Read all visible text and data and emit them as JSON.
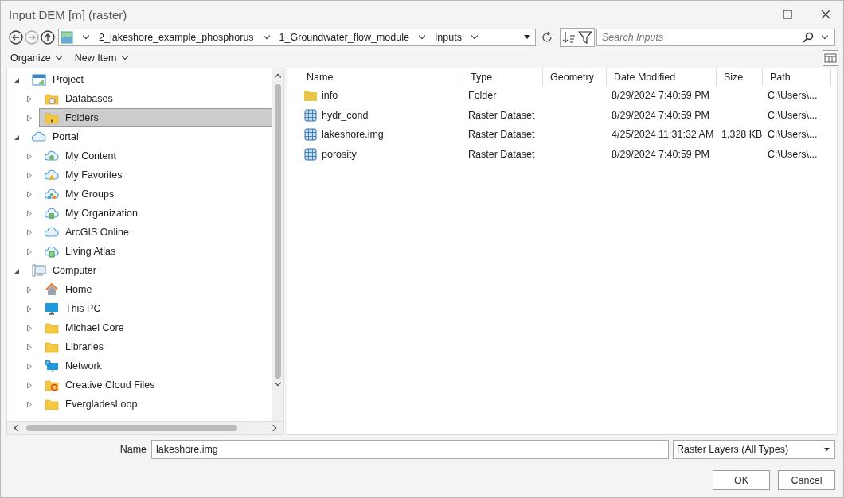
{
  "window": {
    "title": "Input DEM [m] (raster)"
  },
  "breadcrumb": [
    "2_lakeshore_example_phosphorus",
    "1_Groundwater_flow_module",
    "Inputs"
  ],
  "search": {
    "placeholder": "Search Inputs"
  },
  "toolbar": [
    "Organize",
    "New Item"
  ],
  "tree": [
    {
      "label": "Project",
      "kind": "project",
      "expanded": true,
      "selected": false,
      "children": [
        {
          "label": "Databases",
          "kind": "database",
          "expanded": false,
          "selected": false
        },
        {
          "label": "Folders",
          "kind": "homefolder",
          "expanded": false,
          "selected": true
        }
      ]
    },
    {
      "label": "Portal",
      "kind": "cloud",
      "expanded": true,
      "selected": false,
      "children": [
        {
          "label": "My Content",
          "kind": "content",
          "expanded": false,
          "selected": false
        },
        {
          "label": "My Favorites",
          "kind": "favorites",
          "expanded": false,
          "selected": false
        },
        {
          "label": "My Groups",
          "kind": "groups",
          "expanded": false,
          "selected": false
        },
        {
          "label": "My Organization",
          "kind": "organization",
          "expanded": false,
          "selected": false
        },
        {
          "label": "ArcGIS Online",
          "kind": "cloud",
          "expanded": false,
          "selected": false
        },
        {
          "label": "Living Atlas",
          "kind": "atlas",
          "expanded": false,
          "selected": false
        }
      ]
    },
    {
      "label": "Computer",
      "kind": "computer",
      "expanded": true,
      "selected": false,
      "children": [
        {
          "label": "Home",
          "kind": "home",
          "expanded": false,
          "selected": false
        },
        {
          "label": "This PC",
          "kind": "pc",
          "expanded": false,
          "selected": false
        },
        {
          "label": "Michael Core",
          "kind": "folder",
          "expanded": false,
          "selected": false
        },
        {
          "label": "Libraries",
          "kind": "folder",
          "expanded": false,
          "selected": false
        },
        {
          "label": "Network",
          "kind": "network",
          "expanded": false,
          "selected": false
        },
        {
          "label": "Creative Cloud Files",
          "kind": "ccfolder",
          "expanded": false,
          "selected": false
        },
        {
          "label": "EvergladesLoop",
          "kind": "folder",
          "expanded": false,
          "selected": false
        }
      ]
    }
  ],
  "table": {
    "columns": [
      "Name",
      "Type",
      "Geometry",
      "Date Modified",
      "Size",
      "Path"
    ],
    "rows": [
      {
        "kind": "folder",
        "name": "info",
        "type": "Folder",
        "date": "8/29/2024 7:40:59 PM",
        "path": "C:\\Users\\..."
      },
      {
        "kind": "raster",
        "name": "hydr_cond",
        "type": "Raster Dataset",
        "date": "8/29/2024 7:40:59 PM",
        "path": "C:\\Users\\..."
      },
      {
        "kind": "raster",
        "name": "lakeshore.img",
        "type": "Raster Dataset",
        "date": "4/25/2024 11:31:32 AM",
        "size": "1,328 KB",
        "path": "C:\\Users\\..."
      },
      {
        "kind": "raster",
        "name": "porosity",
        "type": "Raster Dataset",
        "date": "8/29/2024 7:40:59 PM",
        "path": "C:\\Users\\..."
      }
    ]
  },
  "name_field": {
    "label": "Name",
    "value": "lakeshore.img"
  },
  "filter": {
    "value": "Raster Layers (All Types)"
  },
  "buttons": [
    "OK",
    "Cancel"
  ]
}
